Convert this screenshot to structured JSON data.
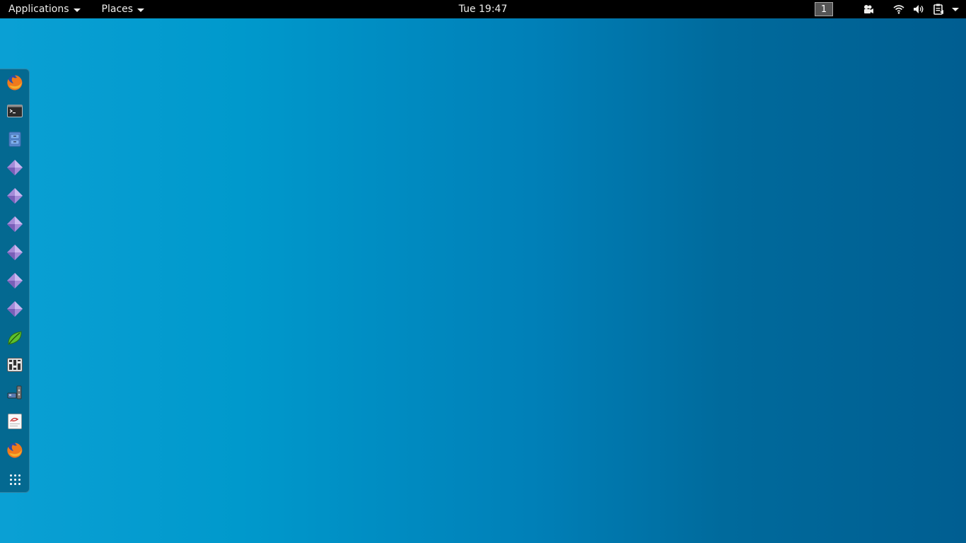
{
  "top_bar": {
    "applications_label": "Applications",
    "places_label": "Places",
    "clock": "Tue 19:47",
    "workspace_number": "1"
  },
  "tray_icons": [
    "camera-icon",
    "wifi-icon",
    "volume-icon",
    "clipboard-icon",
    "chevron-down-icon"
  ],
  "dash_items": [
    {
      "name": "firefox-icon"
    },
    {
      "name": "terminal-icon"
    },
    {
      "name": "file-manager-icon"
    },
    {
      "name": "app-diamond-icon"
    },
    {
      "name": "app-diamond-icon"
    },
    {
      "name": "app-diamond-icon"
    },
    {
      "name": "app-diamond-icon"
    },
    {
      "name": "app-diamond-icon"
    },
    {
      "name": "app-diamond-icon"
    },
    {
      "name": "leaf-app-icon"
    },
    {
      "name": "mixer-icon"
    },
    {
      "name": "network-tool-icon"
    },
    {
      "name": "text-editor-icon"
    },
    {
      "name": "firefox-icon"
    },
    {
      "name": "show-applications-icon"
    }
  ],
  "colors": {
    "panel_bg": "#000000",
    "panel_fg": "#eeeeec",
    "wallpaper_left": "#0aa0d4",
    "wallpaper_right": "#005e91"
  }
}
